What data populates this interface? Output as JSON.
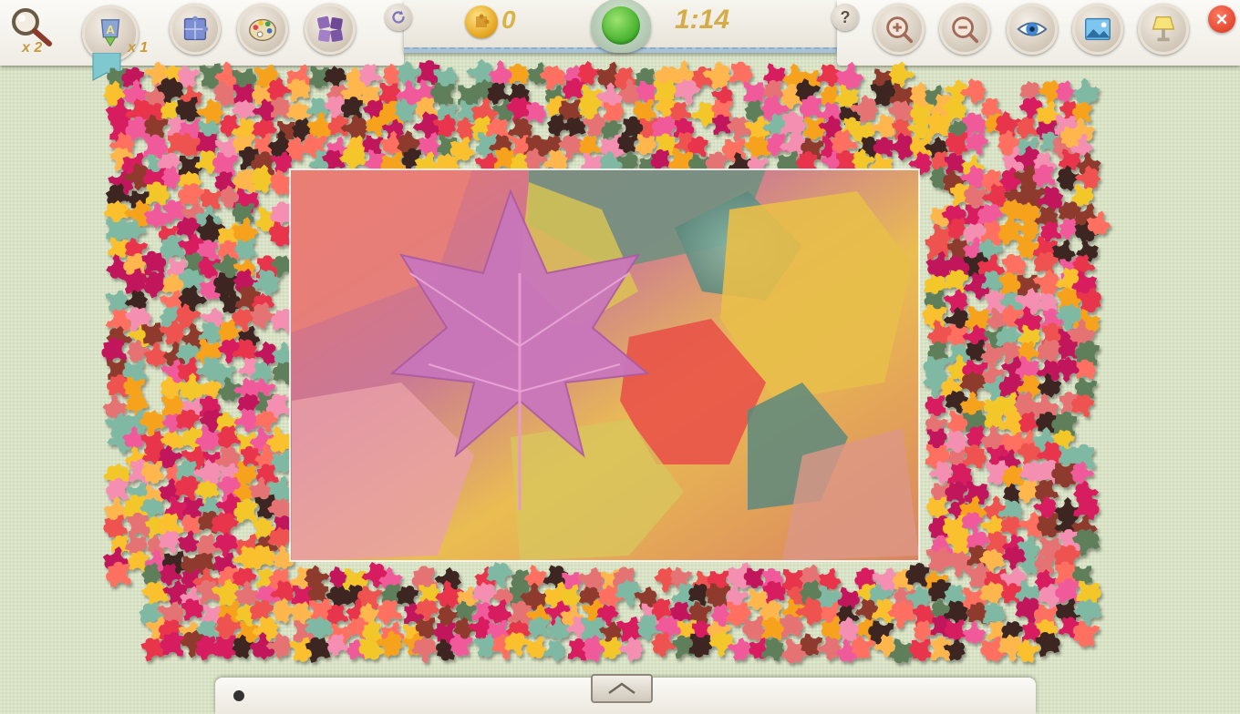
{
  "toolbar": {
    "magnifier": {
      "count": "x 2",
      "icon": "magnifier-icon"
    },
    "auto_place": {
      "count": "x 1",
      "icon": "auto-place-icon",
      "letter": "A"
    },
    "edge_pieces": {
      "icon": "edge-pieces-icon"
    },
    "palette": {
      "icon": "palette-icon"
    },
    "shuffle": {
      "icon": "shuffle-pieces-icon"
    },
    "rotate": {
      "icon": "rotate-icon"
    }
  },
  "status": {
    "coins": "0",
    "timer": "1:14"
  },
  "right_toolbar": {
    "help": {
      "icon": "help-icon",
      "label": "?"
    },
    "zoom_in": {
      "icon": "zoom-in-icon"
    },
    "zoom_out": {
      "icon": "zoom-out-icon"
    },
    "preview": {
      "icon": "eye-icon"
    },
    "background": {
      "icon": "image-icon"
    },
    "lamp": {
      "icon": "lamp-icon"
    },
    "close": {
      "icon": "close-icon"
    }
  },
  "colors": {
    "accent_gold": "#d4ad4a",
    "board_bg": "#d9e4c4",
    "status_green": "#3fae2a",
    "close_red": "#d9321c"
  },
  "board": {
    "image": "autumn maple leaves puzzle",
    "piece_palette": [
      "#e8354b",
      "#f05a9b",
      "#f7a21b",
      "#f3c62b",
      "#c2185b",
      "#ff6f61",
      "#f48fb1",
      "#5f7f5a",
      "#8e3b2e",
      "#e57373",
      "#ffb74d",
      "#d81b60",
      "#3e2723",
      "#7fb8a3",
      "#ef5350",
      "#fbc02d"
    ]
  }
}
